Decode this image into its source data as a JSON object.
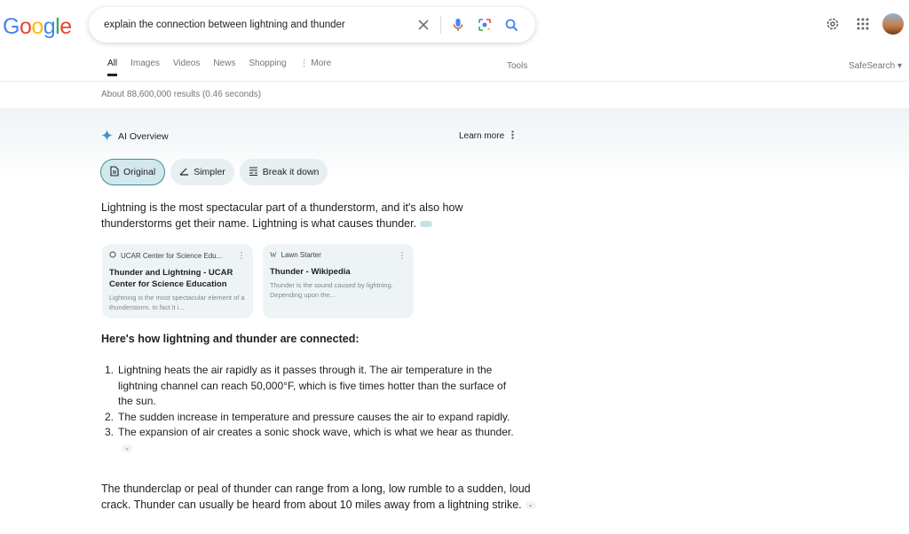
{
  "header": {
    "logo_letters": [
      "G",
      "o",
      "o",
      "g",
      "l",
      "e"
    ],
    "logo_colors": [
      "#4285f4",
      "#ea4335",
      "#fbbc05",
      "#4285f4",
      "#34a853",
      "#ea4335"
    ],
    "query": "explain the connection between lightning and thunder"
  },
  "tabs": [
    {
      "label": "All",
      "active": true
    },
    {
      "label": "Images"
    },
    {
      "label": "Videos"
    },
    {
      "label": "News"
    },
    {
      "label": "Shopping"
    },
    {
      "label": "⋮ More"
    }
  ],
  "tools": "Tools",
  "safesearch": "SafeSearch ▾",
  "result_stats": "About 88,600,000 results (0.46 seconds)",
  "ai_overview": {
    "title": "AI Overview",
    "learn_more": "Learn more",
    "chips": [
      "Original",
      "Simpler",
      "Break it down"
    ],
    "intro": "Lightning is the most spectacular part of a thunderstorm, and it's also how thunderstorms get their name. Lightning is what causes thunder.",
    "cards": [
      {
        "source": "UCAR Center for Science Edu...",
        "title": "Thunder and Lightning - UCAR Center for Science Education",
        "snippet": "Lightning is the most spectacular element of a thunderstorm. In fact it i..."
      },
      {
        "source": "Lawn Starter",
        "title": "Thunder - Wikipedia",
        "snippet": "Thunder is the sound caused by lightning. Depending upon the..."
      }
    ],
    "heading": "Here's how lightning and thunder are connected:",
    "list": [
      {
        "num": "1.",
        "text": "Lightning heats the air rapidly as it passes through it. The air temperature in the lightning channel can reach 50,000°F, which is five times hotter than the surface of the sun."
      },
      {
        "num": "2.",
        "text": "The sudden increase in temperature and pressure causes the air to expand rapidly."
      },
      {
        "num": "3.",
        "text": "The expansion of air creates a sonic shock wave, which is what we hear as thunder."
      }
    ],
    "closing": "The thunderclap or peal of thunder can range from a long, low rumble to a sudden, loud crack. Thunder can usually be heard from about 10 miles away from a lightning strike."
  }
}
